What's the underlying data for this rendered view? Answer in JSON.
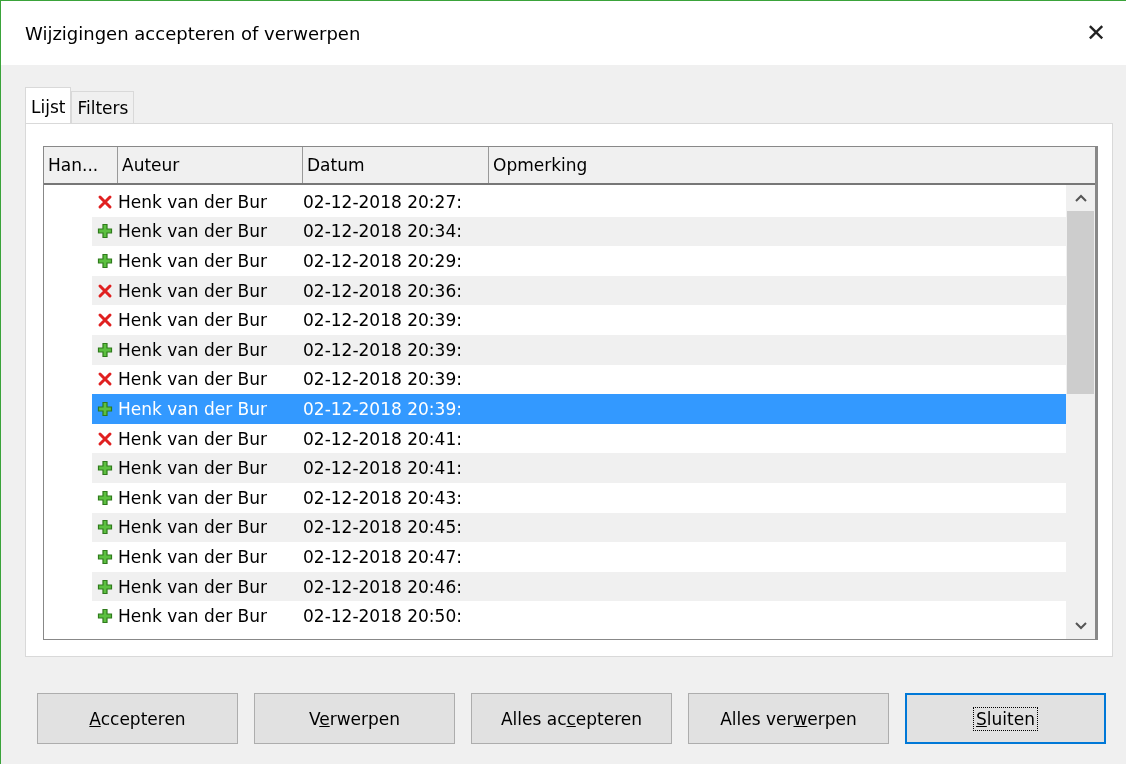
{
  "window": {
    "title": "Wijzigingen accepteren of verwerpen",
    "close": "✕"
  },
  "tabs": [
    {
      "label": "Lijst",
      "selected": true
    },
    {
      "label": "Filters",
      "selected": false
    }
  ],
  "table": {
    "columns": [
      "Han...",
      "Auteur",
      "Datum",
      "Opmerking"
    ],
    "rows": [
      {
        "kind": "delete",
        "author": "Henk van der Bur",
        "date": "02-12-2018 20:27:",
        "selected": false
      },
      {
        "kind": "insert",
        "author": "Henk van der Bur",
        "date": "02-12-2018 20:34:",
        "selected": false
      },
      {
        "kind": "insert",
        "author": "Henk van der Bur",
        "date": "02-12-2018 20:29:",
        "selected": false
      },
      {
        "kind": "delete",
        "author": "Henk van der Bur",
        "date": "02-12-2018 20:36:",
        "selected": false
      },
      {
        "kind": "delete",
        "author": "Henk van der Bur",
        "date": "02-12-2018 20:39:",
        "selected": false
      },
      {
        "kind": "insert",
        "author": "Henk van der Bur",
        "date": "02-12-2018 20:39:",
        "selected": false
      },
      {
        "kind": "delete",
        "author": "Henk van der Bur",
        "date": "02-12-2018 20:39:",
        "selected": false
      },
      {
        "kind": "insert",
        "author": "Henk van der Bur",
        "date": "02-12-2018 20:39:",
        "selected": true
      },
      {
        "kind": "delete",
        "author": "Henk van der Bur",
        "date": "02-12-2018 20:41:",
        "selected": false
      },
      {
        "kind": "insert",
        "author": "Henk van der Bur",
        "date": "02-12-2018 20:41:",
        "selected": false
      },
      {
        "kind": "insert",
        "author": "Henk van der Bur",
        "date": "02-12-2018 20:43:",
        "selected": false
      },
      {
        "kind": "insert",
        "author": "Henk van der Bur",
        "date": "02-12-2018 20:45:",
        "selected": false
      },
      {
        "kind": "insert",
        "author": "Henk van der Bur",
        "date": "02-12-2018 20:47:",
        "selected": false
      },
      {
        "kind": "insert",
        "author": "Henk van der Bur",
        "date": "02-12-2018 20:46:",
        "selected": false
      },
      {
        "kind": "insert",
        "author": "Henk van der Bur",
        "date": "02-12-2018 20:50:",
        "selected": false
      }
    ]
  },
  "buttons": [
    {
      "mnemonic": "A",
      "after": "ccepteren",
      "focused": false
    },
    {
      "before": "V",
      "mnemonic": "e",
      "after": "rwerpen",
      "focused": false
    },
    {
      "before": "Alles ac",
      "mnemonic": "c",
      "after": "epteren",
      "focused": false
    },
    {
      "before": "Alles ver",
      "mnemonic": "w",
      "after": "erpen",
      "focused": false
    },
    {
      "mnemonic": "S",
      "after": "luiten",
      "focused": true
    }
  ]
}
